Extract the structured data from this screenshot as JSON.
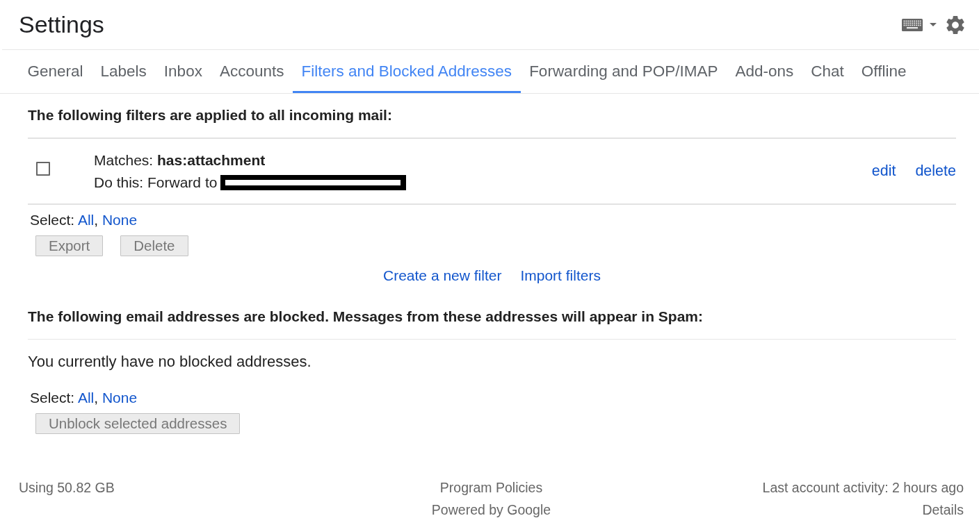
{
  "header": {
    "title": "Settings"
  },
  "tabs": [
    {
      "label": "General",
      "selected": false
    },
    {
      "label": "Labels",
      "selected": false
    },
    {
      "label": "Inbox",
      "selected": false
    },
    {
      "label": "Accounts",
      "selected": false
    },
    {
      "label": "Filters and Blocked Addresses",
      "selected": true
    },
    {
      "label": "Forwarding and POP/IMAP",
      "selected": false
    },
    {
      "label": "Add-ons",
      "selected": false
    },
    {
      "label": "Chat",
      "selected": false
    },
    {
      "label": "Offline",
      "selected": false
    }
  ],
  "filters_section": {
    "heading": "The following filters are applied to all incoming mail:",
    "filters": [
      {
        "checked": false,
        "criteria": "Matches: **has:attachment**",
        "action": "Do this: Forward to",
        "recipient_redacted": true,
        "links": [
          "edit",
          "delete"
        ]
      }
    ],
    "select": {
      "label": "Select:",
      "options": [
        "All",
        "None"
      ],
      "separator": ","
    },
    "buttons": [
      {
        "label": "Export",
        "disabled": true
      },
      {
        "label": "Delete",
        "disabled": true
      }
    ],
    "links": [
      "Create a new filter",
      "Import filters"
    ]
  },
  "blocked_section": {
    "heading": "The following email addresses are blocked. Messages from these addresses will appear in Spam:",
    "empty_message": "You currently have no blocked addresses.",
    "select": {
      "label": "Select:",
      "options": [
        "All",
        "None"
      ],
      "separator": ","
    },
    "buttons": [
      {
        "label": "Unblock selected addresses",
        "disabled": true
      }
    ]
  },
  "footer": {
    "storage": "Using 50.82 GB",
    "policies_link": "Program Policies",
    "powered_by": "Powered by Google",
    "activity": "Last account activity: 2 hours ago",
    "details_link": "Details"
  }
}
